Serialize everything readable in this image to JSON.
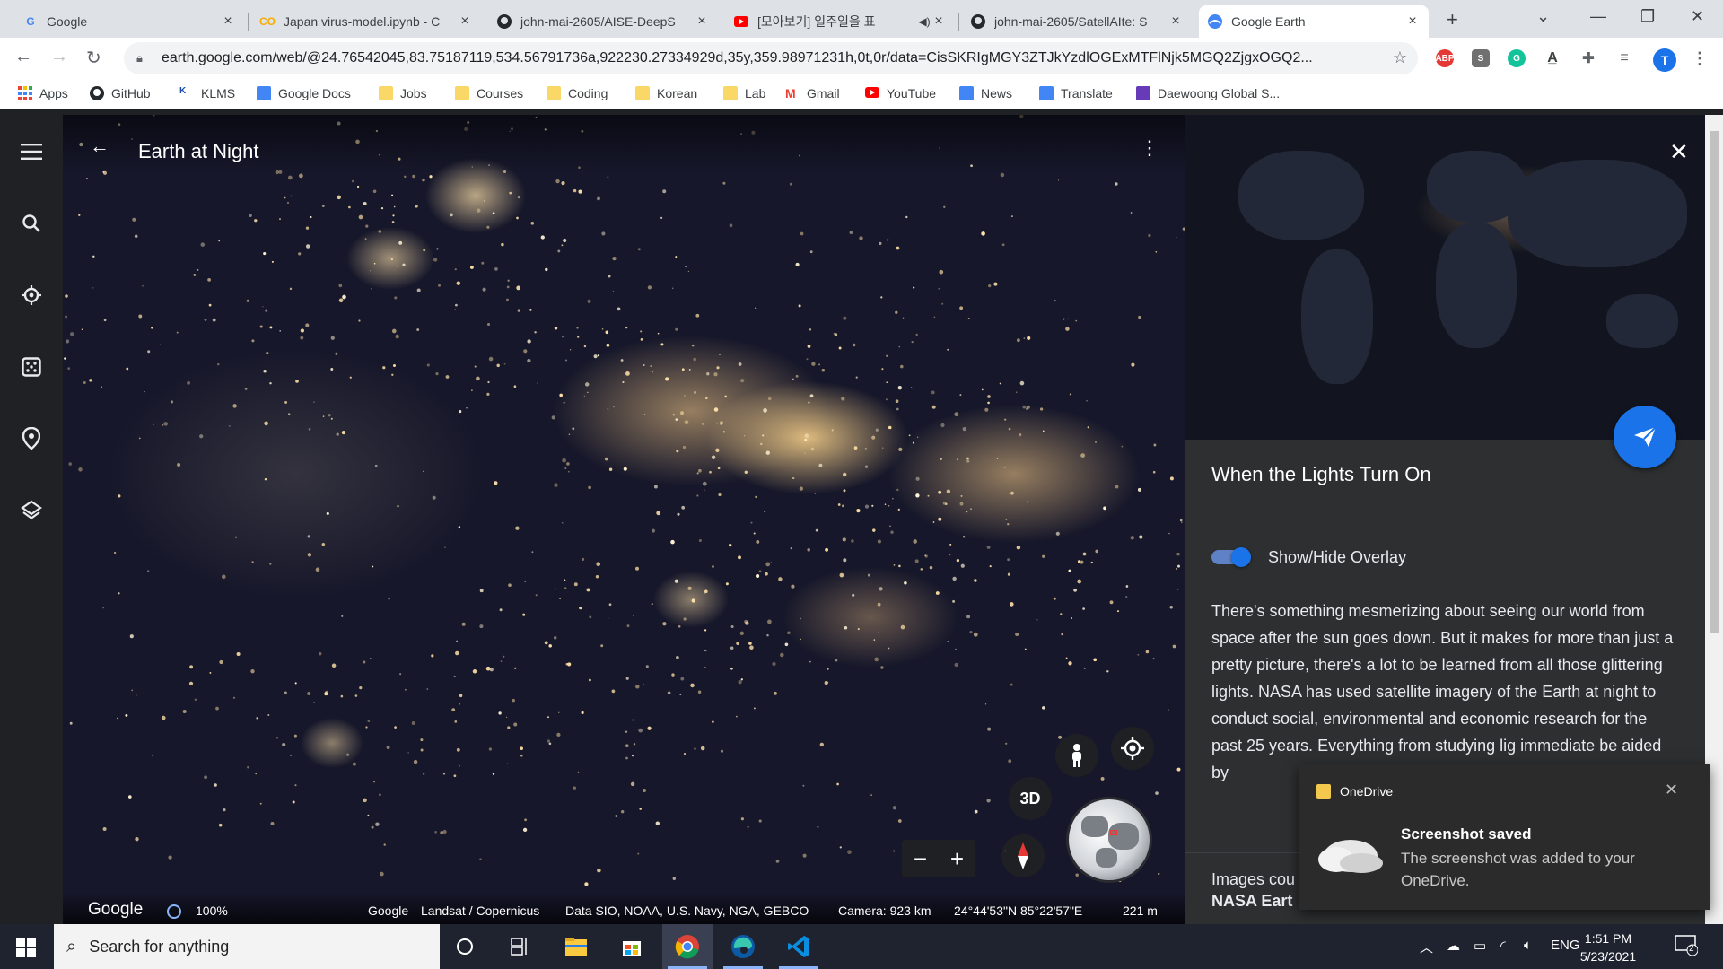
{
  "browser": {
    "tabs": [
      {
        "title": "Google",
        "icon": "google-g-icon",
        "color": "#4285f4"
      },
      {
        "title": "Japan virus-model.ipynb - C",
        "icon": "colab-icon",
        "color": "#f9ab00"
      },
      {
        "title": "john-mai-2605/AISE-DeepS",
        "icon": "github-icon",
        "color": "#24292e"
      },
      {
        "title": "[모아보기] 일주일을 표",
        "icon": "youtube-icon",
        "color": "#ff0000"
      },
      {
        "title": "john-mai-2605/SatellAIte: S",
        "icon": "github-icon",
        "color": "#24292e"
      },
      {
        "title": "Google Earth",
        "icon": "google-earth-icon",
        "color": "#4285f4"
      }
    ],
    "new_tab": "+",
    "url": "earth.google.com/web/@24.76542045,83.75187119,534.56791736a,922230.27334929d,35y,359.98971231h,0t,0r/data=CisSKRIgMGY3ZTJkYzdlOGExMTFlNjk5MGQ2ZjgxOGQ2...",
    "profile_initial": "T",
    "extensions": [
      "ABP",
      "S",
      "G"
    ],
    "bookmarks": [
      {
        "label": "Apps",
        "icon": "apps-grid-icon"
      },
      {
        "label": "GitHub",
        "icon": "github-icon"
      },
      {
        "label": "KLMS",
        "icon": "klms-icon"
      },
      {
        "label": "Google Docs",
        "icon": "docs-icon"
      },
      {
        "label": "Jobs",
        "icon": "folder-icon"
      },
      {
        "label": "Courses",
        "icon": "folder-icon"
      },
      {
        "label": "Coding",
        "icon": "folder-icon"
      },
      {
        "label": "Korean",
        "icon": "folder-icon"
      },
      {
        "label": "Lab",
        "icon": "folder-icon"
      },
      {
        "label": "Gmail",
        "icon": "gmail-icon"
      },
      {
        "label": "YouTube",
        "icon": "youtube-icon"
      },
      {
        "label": "News",
        "icon": "news-icon"
      },
      {
        "label": "Translate",
        "icon": "translate-icon"
      },
      {
        "label": "Daewoong Global S...",
        "icon": "daewoong-icon"
      }
    ]
  },
  "earth": {
    "map_title": "Earth at Night",
    "mode_3d": "3D",
    "zoom_out": "−",
    "zoom_in": "+",
    "status": {
      "logo": "Google",
      "loading": "100%",
      "attribution_google": "Google",
      "attribution_imagery": "Landsat / Copernicus",
      "attribution_data": "Data SIO, NOAA, U.S. Navy, NGA, GEBCO",
      "camera": "Camera: 923 km",
      "coordinates": "24°44'53\"N 85°22'57\"E",
      "scale": "221 m"
    },
    "card": {
      "title": "When the Lights Turn On",
      "toggle_label": "Show/Hide Overlay",
      "toggle_on": true,
      "body": "There's something mesmerizing about seeing our world from space after the sun goes down. But it makes for more than just a pretty picture, there's a lot to be learned from all those glittering lights. NASA has used satellite imagery of the Earth at night to conduct social, environmental and economic research for the past 25 years. Everything from studying lig immediate be aided by",
      "credit_label": "Images cou",
      "credit_name": "NASA Eart"
    }
  },
  "toast": {
    "app": "OneDrive",
    "title": "Screenshot saved",
    "message": "The screenshot was added to your OneDrive."
  },
  "taskbar": {
    "search_placeholder": "Search for anything",
    "language": "ENG",
    "time": "1:51 PM",
    "date": "5/23/2021",
    "notification_count": "2"
  }
}
